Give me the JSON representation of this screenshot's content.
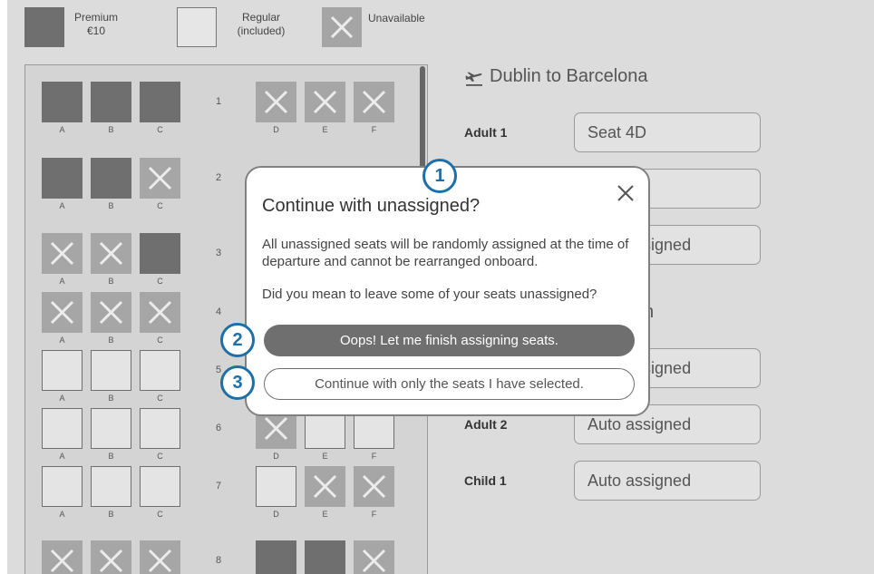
{
  "legend": {
    "premium_label": "Premium",
    "premium_price": "€10",
    "regular_label": "Regular",
    "regular_note": "(included)",
    "unavailable_label": "Unavailable"
  },
  "seat_map": {
    "rows": [
      {
        "number": "1",
        "seats": {
          "A": "premium",
          "B": "premium",
          "C": "premium",
          "D": "unavailable",
          "E": "unavailable",
          "F": "unavailable"
        }
      },
      {
        "number": "2",
        "seats": {
          "A": "premium",
          "B": "premium",
          "C": "unavailable"
        }
      },
      {
        "number": "3",
        "seats": {
          "A": "unavailable",
          "B": "unavailable",
          "C": "premium"
        }
      },
      {
        "number": "4",
        "seats": {
          "A": "unavailable",
          "B": "unavailable",
          "C": "unavailable"
        }
      },
      {
        "number": "5",
        "seats": {
          "A": "regular",
          "B": "regular",
          "C": "regular"
        }
      },
      {
        "number": "6",
        "seats": {
          "A": "regular",
          "B": "regular",
          "C": "regular",
          "D": "unavailable",
          "E": "regular",
          "F": "regular"
        }
      },
      {
        "number": "7",
        "seats": {
          "A": "regular",
          "B": "regular",
          "C": "regular",
          "D": "regular",
          "E": "unavailable",
          "F": "unavailable"
        }
      },
      {
        "number": "8",
        "seats": {
          "A": "unavailable",
          "B": "unavailable",
          "C": "unavailable",
          "D": "premium",
          "E": "premium",
          "F": "unavailable"
        }
      }
    ]
  },
  "flight1": {
    "title": "Dublin to Barcelona",
    "passengers": [
      {
        "label": "Adult 1",
        "value": "Seat 4D"
      },
      {
        "label": "",
        "value": ""
      },
      {
        "label": "",
        "value": "Auto assigned"
      }
    ]
  },
  "flight2": {
    "title": "blin",
    "passengers": [
      {
        "label": "",
        "value": "Auto assigned"
      },
      {
        "label": "Adult 2",
        "value": "Auto assigned"
      },
      {
        "label": "Child 1",
        "value": "Auto assigned"
      }
    ]
  },
  "modal": {
    "title": "Continue with unassigned?",
    "body1": "All unassigned seats will be randomly assigned at the time of departure and cannot be rearranged onboard.",
    "body2": "Did you mean to leave some of your seats unassigned?",
    "primary_button": "Oops! Let me finish assigning seats.",
    "secondary_button": "Continue with only the seats I have selected."
  },
  "callouts": [
    "1",
    "2",
    "3"
  ],
  "colors": {
    "premium": "#6f6f6f",
    "regular": "#e4e4e4",
    "unavailable": "#a6a6a6",
    "callout": "#1e6fa8"
  }
}
